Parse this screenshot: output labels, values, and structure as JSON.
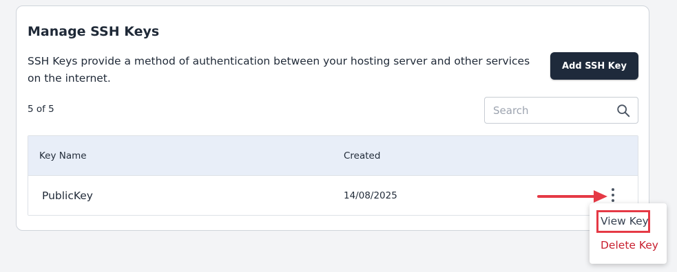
{
  "panel": {
    "title": "Manage SSH Keys",
    "description": "SSH Keys provide a method of authentication between your hosting server and other services on the internet.",
    "add_button_label": "Add SSH Key",
    "count_text": "5 of 5"
  },
  "search": {
    "placeholder": "Search",
    "value": "",
    "icon": "search-icon"
  },
  "table": {
    "columns": [
      "Key Name",
      "Created"
    ],
    "rows": [
      {
        "name": "PublicKey",
        "created": "14/08/2025"
      }
    ]
  },
  "row_actions_menu": {
    "icon": "kebab-vertical-icon",
    "items": [
      {
        "label": "View Key",
        "color": "#374151",
        "highlighted": true
      },
      {
        "label": "Delete Key",
        "color": "#c81e2e"
      }
    ]
  },
  "annotation": {
    "arrow_color": "#e53945",
    "highlight_color": "#e53945"
  },
  "colors": {
    "primary_button": "#1e2a3b",
    "table_header_bg": "#e8eef8",
    "danger": "#c81e2e"
  }
}
